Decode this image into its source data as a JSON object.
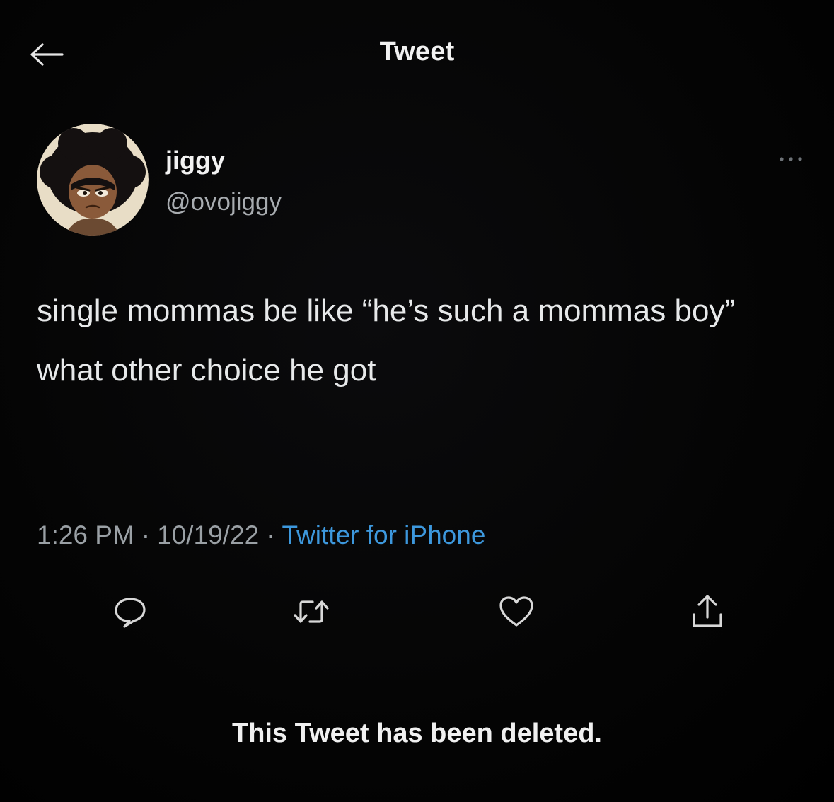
{
  "header": {
    "title": "Tweet",
    "back_icon": "arrow-left-icon"
  },
  "author": {
    "display_name": "jiggy",
    "handle": "@ovojiggy",
    "avatar": "cartoon-avatar"
  },
  "tweet": {
    "text": "single mommas be like “he’s such a mommas boy” what other choice he got"
  },
  "meta": {
    "time": "1:26 PM",
    "separator": "·",
    "date": "10/19/22",
    "source": "Twitter for iPhone"
  },
  "actions": {
    "reply_icon": "reply-icon",
    "retweet_icon": "retweet-icon",
    "like_icon": "heart-icon",
    "share_icon": "share-icon"
  },
  "notice": "This Tweet has been deleted.",
  "colors": {
    "background": "#000000",
    "text": "#e7e9ea",
    "secondary": "#9aa0a5",
    "link": "#3d98dd"
  }
}
